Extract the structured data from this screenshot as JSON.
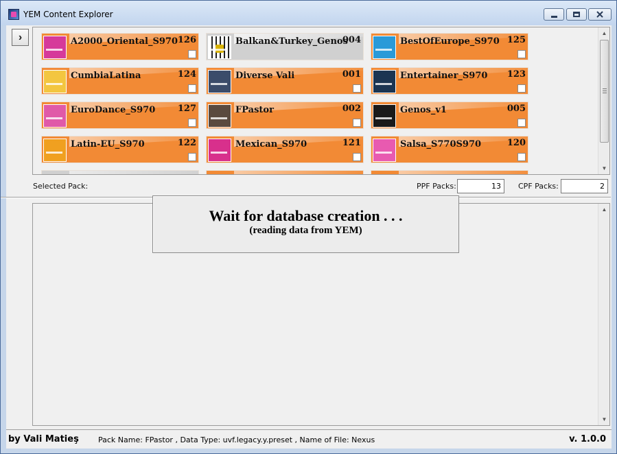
{
  "window": {
    "title": "YEM Content Explorer"
  },
  "toolbar": {
    "expand_glyph": "›"
  },
  "packs": [
    {
      "name": "A2000_Oriental_S970",
      "number": "126",
      "thumb_color": "#d63a9a",
      "style": "orange"
    },
    {
      "name": "Balkan&Turkey_Genos",
      "number": "004",
      "thumb_color": "#d9b300",
      "style": "gray"
    },
    {
      "name": "BestOfEurope_S970",
      "number": "125",
      "thumb_color": "#2a9ad8",
      "style": "orange"
    },
    {
      "name": "CumbiaLatina",
      "number": "124",
      "thumb_color": "#f3c640",
      "style": "orange"
    },
    {
      "name": "Diverse Vali",
      "number": "001",
      "thumb_color": "#3b4c6a",
      "style": "orange"
    },
    {
      "name": "Entertainer_S970",
      "number": "123",
      "thumb_color": "#1b3552",
      "style": "orange"
    },
    {
      "name": "EuroDance_S970",
      "number": "127",
      "thumb_color": "#e05aa8",
      "style": "orange"
    },
    {
      "name": "FPastor",
      "number": "002",
      "thumb_color": "#5a4a3f",
      "style": "orange"
    },
    {
      "name": "Genos_v1",
      "number": "005",
      "thumb_color": "#1a1a1a",
      "style": "orange"
    },
    {
      "name": "Latin-EU_S970",
      "number": "122",
      "thumb_color": "#f0a020",
      "style": "orange"
    },
    {
      "name": "Mexican_S970",
      "number": "121",
      "thumb_color": "#d8308c",
      "style": "orange"
    },
    {
      "name": "Salsa_S770S970",
      "number": "120",
      "thumb_color": "#e85ab0",
      "style": "orange"
    }
  ],
  "selection": {
    "selected_pack_label": "Selected Pack:",
    "ppf_label": "PPF Packs:",
    "ppf_value": "13",
    "cpf_label": "CPF Packs:",
    "cpf_value": "2"
  },
  "wait_dialog": {
    "title": "Wait for database creation . . .",
    "subtitle": "(reading data from YEM)"
  },
  "status": {
    "author": "by Vali Matieş",
    "info": "Pack Name: FPastor , Data Type: uvf.legacy.y.preset , Name of File: Nexus",
    "version": "v. 1.0.0"
  }
}
